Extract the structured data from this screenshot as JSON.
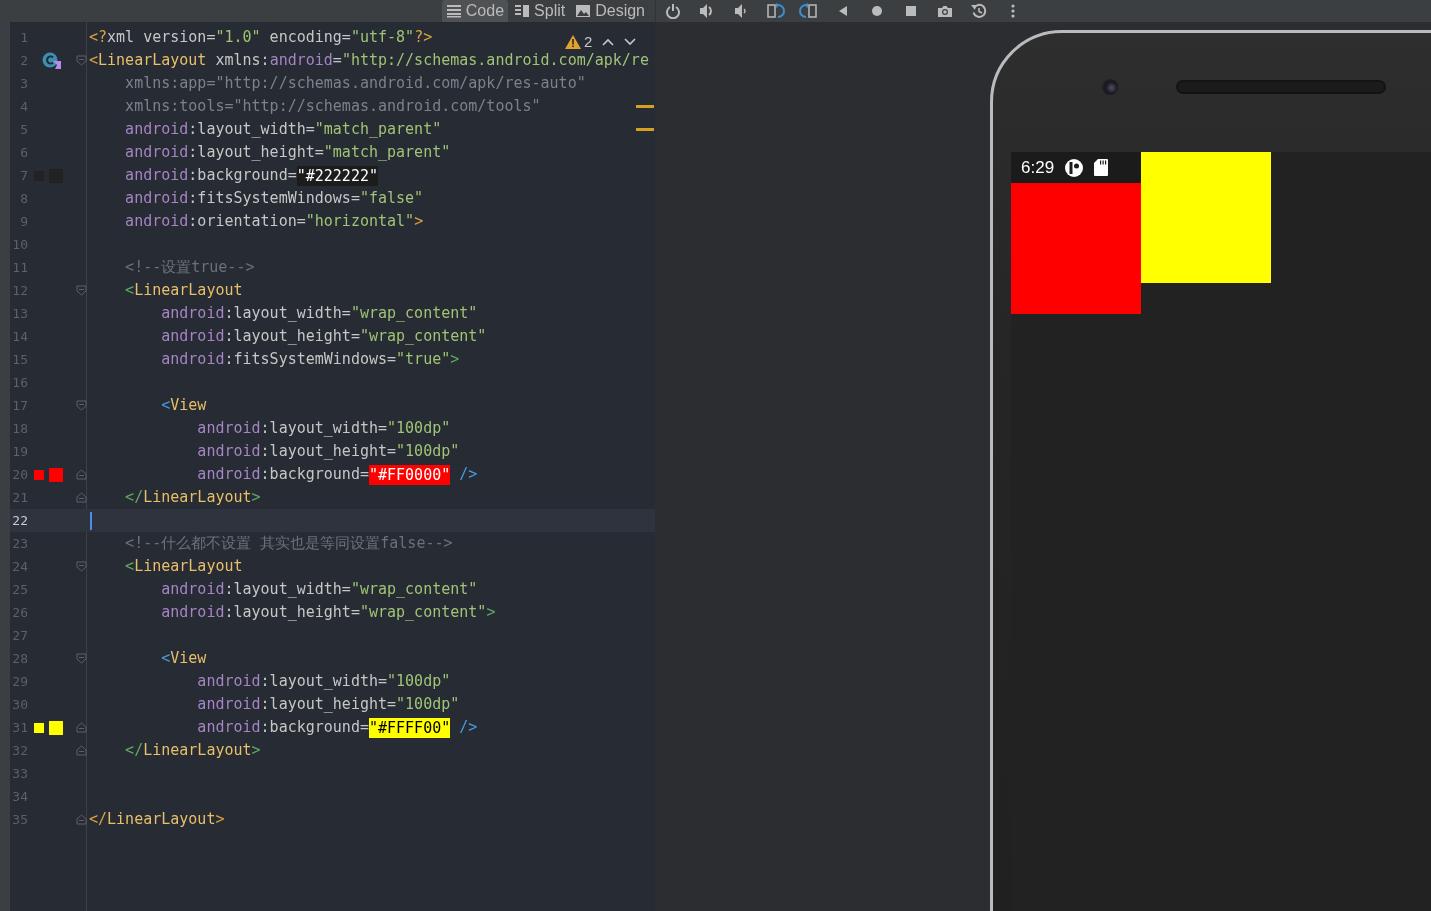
{
  "editor_tabs": [
    {
      "label": "Code",
      "selected": true
    },
    {
      "label": "Split",
      "selected": false
    },
    {
      "label": "Design",
      "selected": false
    }
  ],
  "warnings": {
    "count": "2"
  },
  "lines": [
    {
      "number": "1",
      "current": false,
      "tokens": [
        {
          "text": "<?",
          "color": "#d9a343"
        },
        {
          "text": "xml version=",
          "color": "#c5c8c6"
        },
        {
          "text": "\"1.0\"",
          "color": "#9fc475"
        },
        {
          "text": " encoding=",
          "color": "#c5c8c6"
        },
        {
          "text": "\"utf-8\"",
          "color": "#9fc475"
        },
        {
          "text": "?>",
          "color": "#d9a343"
        }
      ]
    },
    {
      "number": "2",
      "current": false,
      "gutter_icon": {
        "kind": "class"
      },
      "fold": {
        "kind": "start"
      },
      "tokens": [
        {
          "text": "<",
          "color": "#d9a343"
        },
        {
          "text": "LinearLayout",
          "color": "#e8bf6a"
        },
        {
          "text": " xmlns:",
          "color": "#c5c8c6"
        },
        {
          "text": "android",
          "color": "#a585c4"
        },
        {
          "text": "=",
          "color": "#c5c8c6"
        },
        {
          "text": "\"http://schemas.android.com/apk/re",
          "color": "#9fc475"
        }
      ]
    },
    {
      "number": "3",
      "current": false,
      "tokens": [
        {
          "text": "    xmlns:app=\"http://schemas.android.com/apk/res-auto\"",
          "color": "#7c818a"
        }
      ]
    },
    {
      "number": "4",
      "current": false,
      "tokens": [
        {
          "text": "    xmlns:tools=\"http://schemas.android.com/tools\"",
          "color": "#7c818a"
        }
      ]
    },
    {
      "number": "5",
      "current": false,
      "tokens": [
        {
          "text": "    android",
          "color": "#a585c4"
        },
        {
          "text": ":layout_width=",
          "color": "#c5c8c6"
        },
        {
          "text": "\"match_parent\"",
          "color": "#9fc475"
        }
      ]
    },
    {
      "number": "6",
      "current": false,
      "tokens": [
        {
          "text": "    android",
          "color": "#a585c4"
        },
        {
          "text": ":layout_height=",
          "color": "#c5c8c6"
        },
        {
          "text": "\"match_parent\"",
          "color": "#9fc475"
        }
      ]
    },
    {
      "number": "7",
      "current": false,
      "color": "#222222",
      "tokens": [
        {
          "text": "    android",
          "color": "#a585c4"
        },
        {
          "text": ":background=",
          "color": "#c5c8c6"
        },
        {
          "text": "\"#222222\"",
          "kind": "swatch",
          "color": "#1c1c1c"
        }
      ]
    },
    {
      "number": "8",
      "current": false,
      "tokens": [
        {
          "text": "    android",
          "color": "#a585c4"
        },
        {
          "text": ":fitsSystemWindows=",
          "color": "#c5c8c6"
        },
        {
          "text": "\"false\"",
          "color": "#9fc475"
        }
      ]
    },
    {
      "number": "9",
      "current": false,
      "tokens": [
        {
          "text": "    android",
          "color": "#a585c4"
        },
        {
          "text": ":orientation=",
          "color": "#c5c8c6"
        },
        {
          "text": "\"horizontal\"",
          "color": "#9fc475"
        },
        {
          "text": ">",
          "color": "#d9a343"
        }
      ]
    },
    {
      "number": "10",
      "current": false
    },
    {
      "number": "11",
      "current": false,
      "tokens": [
        {
          "text": "    <!--设置true-->",
          "color": "#6c7079"
        }
      ]
    },
    {
      "number": "12",
      "current": false,
      "fold": {
        "kind": "start"
      },
      "tokens": [
        {
          "text": "    <",
          "color": "#62a862"
        },
        {
          "text": "LinearLayout",
          "color": "#e8bf6a"
        }
      ]
    },
    {
      "number": "13",
      "current": false,
      "tokens": [
        {
          "text": "        android",
          "color": "#a585c4"
        },
        {
          "text": ":layout_width=",
          "color": "#c5c8c6"
        },
        {
          "text": "\"wrap_content\"",
          "color": "#9fc475"
        }
      ]
    },
    {
      "number": "14",
      "current": false,
      "tokens": [
        {
          "text": "        android",
          "color": "#a585c4"
        },
        {
          "text": ":layout_height=",
          "color": "#c5c8c6"
        },
        {
          "text": "\"wrap_content\"",
          "color": "#9fc475"
        }
      ]
    },
    {
      "number": "15",
      "current": false,
      "tokens": [
        {
          "text": "        android",
          "color": "#a585c4"
        },
        {
          "text": ":fitsSystemWindows=",
          "color": "#c5c8c6"
        },
        {
          "text": "\"true\"",
          "color": "#9fc475"
        },
        {
          "text": ">",
          "color": "#62a862"
        }
      ]
    },
    {
      "number": "16",
      "current": false
    },
    {
      "number": "17",
      "current": false,
      "fold": {
        "kind": "start"
      },
      "tokens": [
        {
          "text": "        <",
          "color": "#4a9be0"
        },
        {
          "text": "View",
          "color": "#e8bf6a"
        }
      ]
    },
    {
      "number": "18",
      "current": false,
      "tokens": [
        {
          "text": "            android",
          "color": "#a585c4"
        },
        {
          "text": ":layout_width=",
          "color": "#c5c8c6"
        },
        {
          "text": "\"100dp\"",
          "color": "#9fc475"
        }
      ]
    },
    {
      "number": "19",
      "current": false,
      "tokens": [
        {
          "text": "            android",
          "color": "#a585c4"
        },
        {
          "text": ":layout_height=",
          "color": "#c5c8c6"
        },
        {
          "text": "\"100dp\"",
          "color": "#9fc475"
        }
      ]
    },
    {
      "number": "20",
      "current": false,
      "color": "#ff0000",
      "fold": {
        "kind": "end"
      },
      "tokens": [
        {
          "text": "            android",
          "color": "#a585c4"
        },
        {
          "text": ":background=",
          "color": "#c5c8c6"
        },
        {
          "text": "\"#FF0000\"",
          "kind": "swatch",
          "color": "#ff0000"
        },
        {
          "text": " />",
          "color": "#4a9be0"
        }
      ]
    },
    {
      "number": "21",
      "current": false,
      "fold": {
        "kind": "end"
      },
      "tokens": [
        {
          "text": "    </",
          "color": "#62a862"
        },
        {
          "text": "LinearLayout",
          "color": "#e8bf6a"
        },
        {
          "text": ">",
          "color": "#62a862"
        }
      ]
    },
    {
      "number": "22",
      "current": true
    },
    {
      "number": "23",
      "current": false,
      "tokens": [
        {
          "text": "    <!--什么都不设置 其实也是等同设置false-->",
          "color": "#6c7079"
        }
      ]
    },
    {
      "number": "24",
      "current": false,
      "fold": {
        "kind": "start"
      },
      "tokens": [
        {
          "text": "    <",
          "color": "#62a862"
        },
        {
          "text": "LinearLayout",
          "color": "#e8bf6a"
        }
      ]
    },
    {
      "number": "25",
      "current": false,
      "tokens": [
        {
          "text": "        android",
          "color": "#a585c4"
        },
        {
          "text": ":layout_width=",
          "color": "#c5c8c6"
        },
        {
          "text": "\"wrap_content\"",
          "color": "#9fc475"
        }
      ]
    },
    {
      "number": "26",
      "current": false,
      "tokens": [
        {
          "text": "        android",
          "color": "#a585c4"
        },
        {
          "text": ":layout_height=",
          "color": "#c5c8c6"
        },
        {
          "text": "\"wrap_content\"",
          "color": "#9fc475"
        },
        {
          "text": ">",
          "color": "#62a862"
        }
      ]
    },
    {
      "number": "27",
      "current": false
    },
    {
      "number": "28",
      "current": false,
      "fold": {
        "kind": "start"
      },
      "tokens": [
        {
          "text": "        <",
          "color": "#4a9be0"
        },
        {
          "text": "View",
          "color": "#e8bf6a"
        }
      ]
    },
    {
      "number": "29",
      "current": false,
      "tokens": [
        {
          "text": "            android",
          "color": "#a585c4"
        },
        {
          "text": ":layout_width=",
          "color": "#c5c8c6"
        },
        {
          "text": "\"100dp\"",
          "color": "#9fc475"
        }
      ]
    },
    {
      "number": "30",
      "current": false,
      "tokens": [
        {
          "text": "            android",
          "color": "#a585c4"
        },
        {
          "text": ":layout_height=",
          "color": "#c5c8c6"
        },
        {
          "text": "\"100dp\"",
          "color": "#9fc475"
        }
      ]
    },
    {
      "number": "31",
      "current": false,
      "color": "#ffff00",
      "fold": {
        "kind": "end"
      },
      "tokens": [
        {
          "text": "            android",
          "color": "#a585c4"
        },
        {
          "text": ":background=",
          "color": "#c5c8c6"
        },
        {
          "text": "\"#FFFF00\"",
          "kind": "swatch",
          "color": "#ffff00"
        },
        {
          "text": " />",
          "color": "#4a9be0"
        }
      ]
    },
    {
      "number": "32",
      "current": false,
      "fold": {
        "kind": "end"
      },
      "tokens": [
        {
          "text": "    </",
          "color": "#62a862"
        },
        {
          "text": "LinearLayout",
          "color": "#e8bf6a"
        },
        {
          "text": ">",
          "color": "#62a862"
        }
      ]
    },
    {
      "number": "33",
      "current": false
    },
    {
      "number": "34",
      "current": false
    },
    {
      "number": "35",
      "current": false,
      "fold": {
        "kind": "end"
      },
      "tokens": [
        {
          "text": "</",
          "color": "#d9a343"
        },
        {
          "text": "LinearLayout",
          "color": "#e8bf6a"
        },
        {
          "text": ">",
          "color": "#d9a343"
        }
      ]
    }
  ],
  "preview": {
    "status_bar": {
      "time": "6:29"
    },
    "views": [
      {
        "color": "#ff0000",
        "below_status_bar": true
      },
      {
        "color": "#ffff00",
        "below_status_bar": false
      }
    ]
  }
}
